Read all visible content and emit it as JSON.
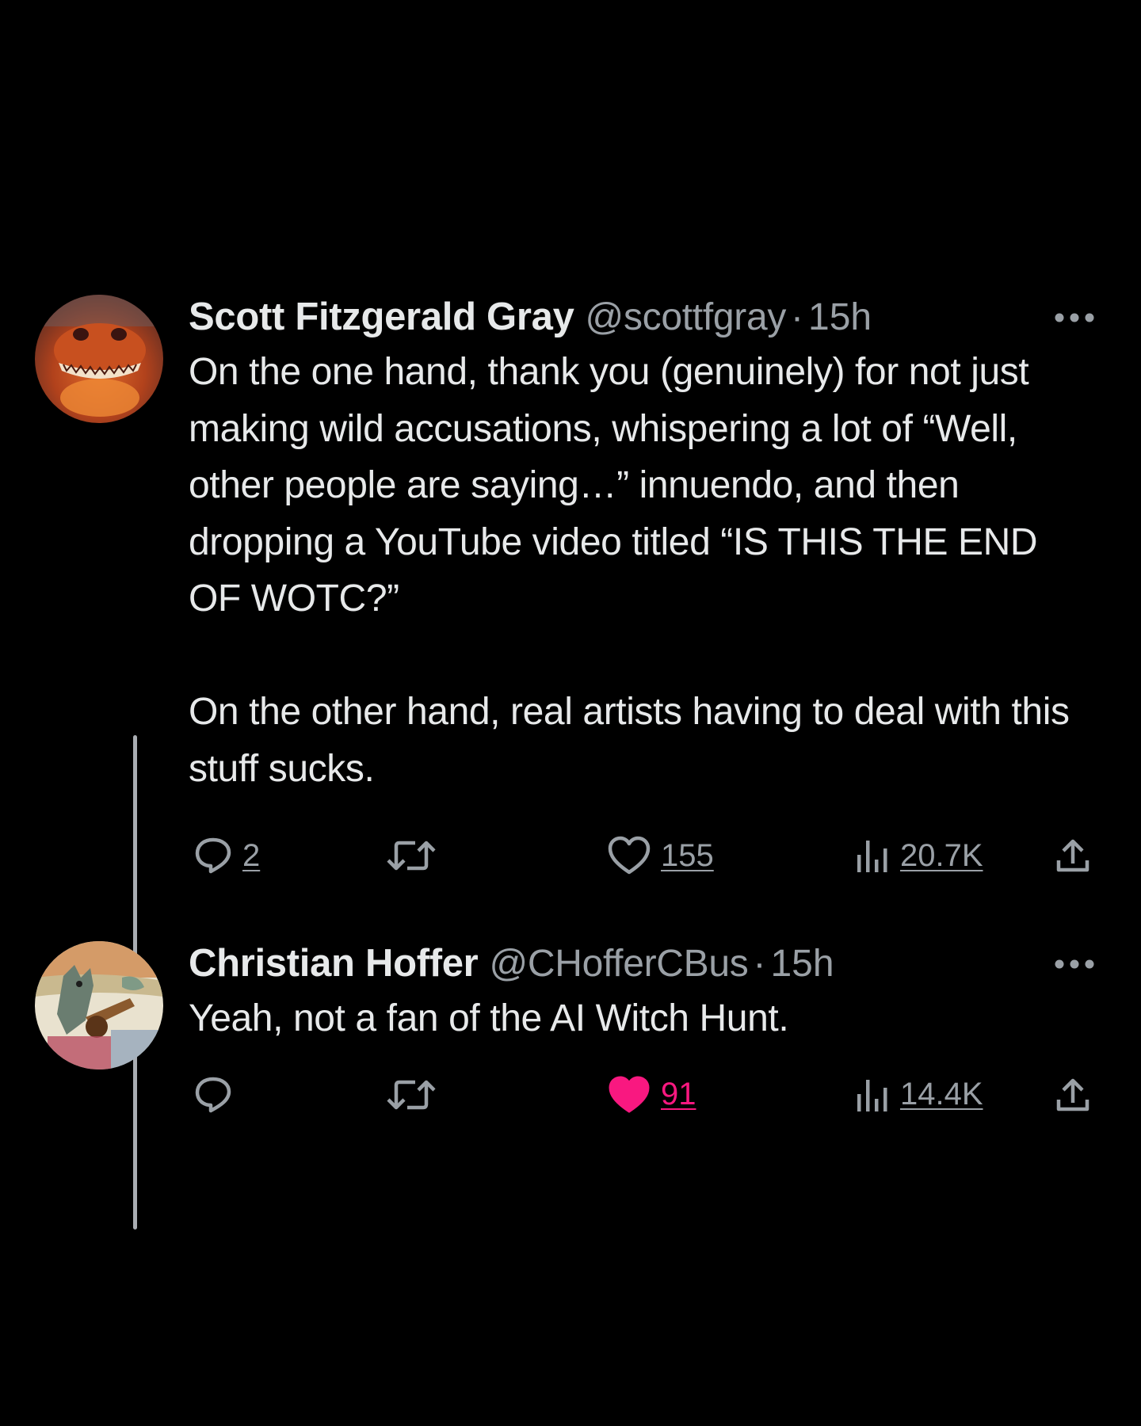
{
  "colors": {
    "background": "#000000",
    "text_primary": "#e7e9ea",
    "text_secondary": "#9aa0a6",
    "like_active": "#f91880",
    "thread_line": "#a9adb2"
  },
  "tweets": [
    {
      "display_name": "Scott Fitzgerald Gray",
      "handle": "@scottfgray",
      "separator": "·",
      "time": "15h",
      "text": "On the one hand, thank you (genuinely) for not just making wild accusations, whispering a lot of “Well, other people are saying…” innuendo, and then dropping a YouTube video titled “IS THIS THE END OF WOTC?”\n\nOn the other hand, real artists having to deal with this stuff sucks.",
      "avatar_icon": "red-dragon-avatar",
      "actions": {
        "reply": {
          "icon": "reply-icon",
          "count": "2"
        },
        "retweet": {
          "icon": "retweet-icon",
          "count": ""
        },
        "like": {
          "icon": "heart-outline-icon",
          "count": "155",
          "liked": false
        },
        "views": {
          "icon": "views-bar-chart-icon",
          "count": "20.7K"
        },
        "share": {
          "icon": "share-icon"
        }
      }
    },
    {
      "display_name": "Christian Hoffer",
      "handle": "@CHofferCBus",
      "separator": "·",
      "time": "15h",
      "text": "Yeah, not a fan of the AI Witch Hunt.",
      "avatar_icon": "kaiju-guitar-avatar",
      "actions": {
        "reply": {
          "icon": "reply-icon",
          "count": ""
        },
        "retweet": {
          "icon": "retweet-icon",
          "count": ""
        },
        "like": {
          "icon": "heart-filled-icon",
          "count": "91",
          "liked": true
        },
        "views": {
          "icon": "views-bar-chart-icon",
          "count": "14.4K"
        },
        "share": {
          "icon": "share-icon"
        }
      }
    }
  ]
}
